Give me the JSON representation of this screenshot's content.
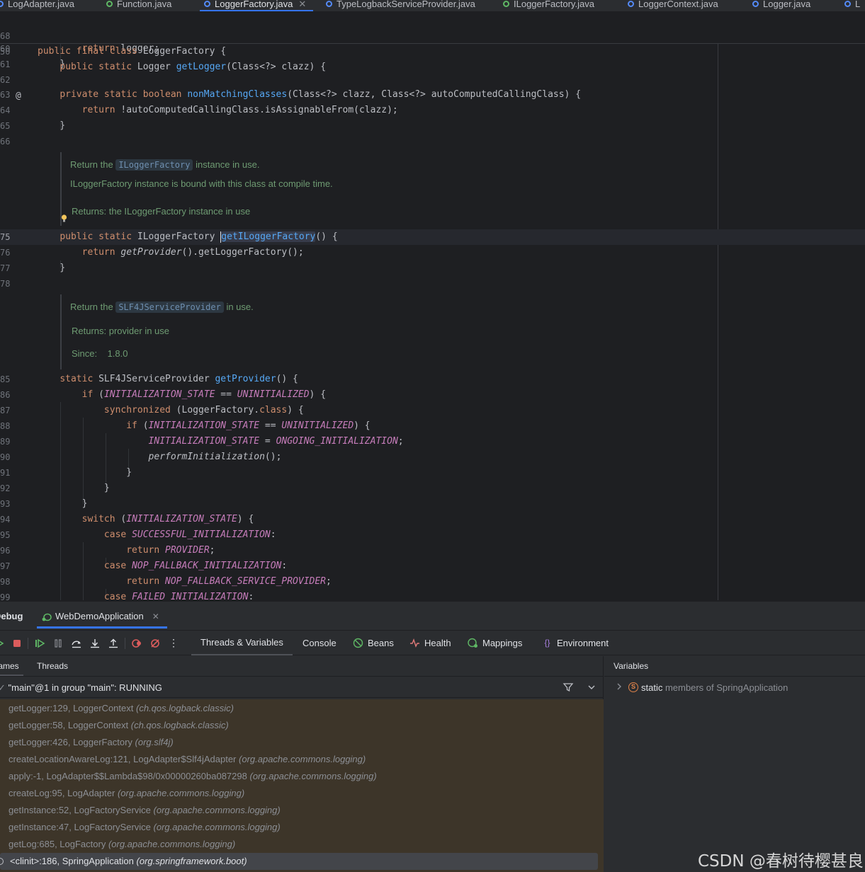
{
  "tabs": [
    {
      "label": "LogAdapter.java",
      "icon": "class-icon",
      "active": false
    },
    {
      "label": "Function.java",
      "icon": "interface-icon",
      "active": false
    },
    {
      "label": "LoggerFactory.java",
      "icon": "class-icon",
      "active": true
    },
    {
      "label": "TypeLogbackServiceProvider.java",
      "icon": "class-icon",
      "active": false
    },
    {
      "label": "ILoggerFactory.java",
      "icon": "interface-icon",
      "active": false
    },
    {
      "label": "LoggerContext.java",
      "icon": "class-icon",
      "active": false
    },
    {
      "label": "Logger.java",
      "icon": "class-icon",
      "active": false
    },
    {
      "label": "L",
      "icon": "class-icon",
      "active": false
    }
  ],
  "editor": {
    "sticky": [
      {
        "ln": "68",
        "text": "public final class LoggerFactory {"
      },
      {
        "ln": "50",
        "text": "public static Logger getLogger(Class<?> clazz) {"
      }
    ],
    "doc1": {
      "line1_before": "Return the",
      "line1_chip": "ILoggerFactory",
      "line1_after": "instance in use.",
      "line2": "ILoggerFactory instance is bound with this class at compile time.",
      "line3": "Returns: the ILoggerFactory instance in use"
    },
    "doc2": {
      "line1_before": "Return the",
      "line1_chip": "SLF4JServiceProvider",
      "line1_after": "in use.",
      "line2": "Returns: provider in use",
      "line3": "Since:    1.8.0"
    },
    "line_numbers": {
      "l60": "60",
      "l61": "61",
      "l62": "62",
      "l63": "63",
      "l64": "64",
      "l65": "65",
      "l66": "66",
      "l75": "75",
      "l76": "76",
      "l77": "77",
      "l78": "78",
      "l85": "85",
      "l86": "86",
      "l87": "87",
      "l88": "88",
      "l89": "89",
      "l90": "90",
      "l91": "91",
      "l92": "92",
      "l93": "93",
      "l94": "94",
      "l95": "95",
      "l96": "96",
      "l97": "97",
      "l98": "98",
      "l99": "99"
    }
  },
  "debug": {
    "title": "Debug",
    "run_tab": "WebDemoApplication",
    "toolbar_tabs": [
      "Threads & Variables",
      "Console",
      "Beans",
      "Health",
      "Mappings",
      "Environment"
    ],
    "frames_tab": "Frames",
    "threads_tab": "Threads",
    "thread": "\"main\"@1 in group \"main\": RUNNING",
    "frames": [
      {
        "method": "getLogger:129, LoggerContext",
        "pkg": "(ch.qos.logback.classic)"
      },
      {
        "method": "getLogger:58, LoggerContext",
        "pkg": "(ch.qos.logback.classic)"
      },
      {
        "method": "getLogger:426, LoggerFactory",
        "pkg": "(org.slf4j)"
      },
      {
        "method": "createLocationAwareLog:121, LogAdapter$Slf4jAdapter",
        "pkg": "(org.apache.commons.logging)"
      },
      {
        "method": "apply:-1, LogAdapter$$Lambda$98/0x00000260ba087298",
        "pkg": "(org.apache.commons.logging)"
      },
      {
        "method": "createLog:95, LogAdapter",
        "pkg": "(org.apache.commons.logging)"
      },
      {
        "method": "getInstance:52, LogFactoryService",
        "pkg": "(org.apache.commons.logging)"
      },
      {
        "method": "getInstance:47, LogFactoryService",
        "pkg": "(org.apache.commons.logging)"
      },
      {
        "method": "getLog:685, LogFactory",
        "pkg": "(org.apache.commons.logging)"
      },
      {
        "method": "<clinit>:186, SpringApplication",
        "pkg": "(org.springframework.boot)"
      }
    ],
    "variables_title": "Variables",
    "variables_row_prefix": "static",
    "variables_row_rest": "members of SpringApplication"
  },
  "watermark": "CSDN @春树待樱甚良",
  "colors": {
    "background": "#1e1f22",
    "panel": "#2b2d30",
    "accent": "#3574f0",
    "keyword": "#cf8e6d",
    "method": "#56a8f5",
    "static_field": "#c77dbb",
    "doc_comment": "#6e9b72",
    "frames_bg": "#3d3529"
  }
}
